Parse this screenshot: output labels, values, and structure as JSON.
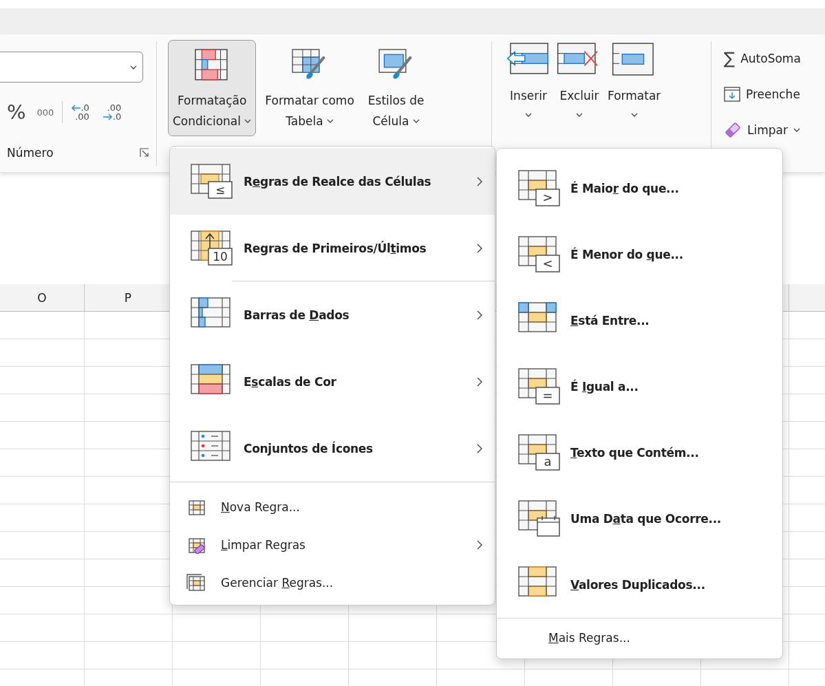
{
  "ribbon": {
    "number_group": {
      "label": "Número",
      "percent": "%",
      "thousands": "000",
      "decimal_buttons": [
        {
          "kind": "increase",
          "top": ".0",
          "bottom": ".00"
        },
        {
          "kind": "decrease",
          "top": ".00",
          "bottom": ".0"
        }
      ]
    },
    "style_buttons": [
      {
        "lines": [
          "Formatação",
          "Condicional"
        ],
        "dropdown": true,
        "pressed": true
      },
      {
        "lines": [
          "Formatar como",
          "Tabela"
        ],
        "dropdown": true,
        "pressed": false
      },
      {
        "lines": [
          "Estilos de",
          "Célula"
        ],
        "dropdown": true,
        "pressed": false
      }
    ],
    "cell_buttons": [
      {
        "label": "Inserir",
        "dropdown": true
      },
      {
        "label": "Excluir",
        "dropdown": true
      },
      {
        "label": "Formatar",
        "dropdown": true
      }
    ],
    "editing_buttons": [
      {
        "label": "AutoSoma",
        "icon_text": "∑",
        "dropdown": false
      },
      {
        "label": "Preenche",
        "dropdown": false
      },
      {
        "label": "Limpar",
        "dropdown": true
      }
    ]
  },
  "sheet": {
    "columns": [
      "O",
      "P"
    ]
  },
  "menu": {
    "items": [
      {
        "kind": "large",
        "label": {
          "before": "R",
          "key": "e",
          "after": "gras de Realce das Células"
        },
        "icon_text": "≤",
        "has_submenu": true,
        "selected": true,
        "separator_after": false
      },
      {
        "kind": "large",
        "label": {
          "before": "Regras de Primeiros/Úl",
          "key": "t",
          "after": "imos"
        },
        "icon_text": "10",
        "has_submenu": true,
        "selected": false,
        "separator_after": true
      },
      {
        "kind": "large",
        "label": {
          "before": "Barras de ",
          "key": "D",
          "after": "ados"
        },
        "has_submenu": true,
        "selected": false,
        "separator_after": false
      },
      {
        "kind": "large",
        "label": {
          "before": "E",
          "key": "s",
          "after": "calas de Cor"
        },
        "has_submenu": true,
        "selected": false,
        "separator_after": false
      },
      {
        "kind": "large",
        "label": "Conjuntos de Ícones",
        "has_submenu": true,
        "selected": false,
        "separator_after": false
      },
      {
        "kind": "small",
        "label": {
          "key": "N",
          "after": "ova Regra..."
        },
        "has_submenu": false,
        "selected": false,
        "separator_after": false
      },
      {
        "kind": "small",
        "label": {
          "key": "L",
          "after": "impar Regras"
        },
        "has_submenu": true,
        "selected": false,
        "separator_after": false
      },
      {
        "kind": "small",
        "label": {
          "before": "Gerenciar ",
          "key": "R",
          "after": "egras..."
        },
        "has_submenu": false,
        "selected": false,
        "separator_after": false
      }
    ]
  },
  "submenu": {
    "items": [
      {
        "label": {
          "before": "É Maio",
          "key": "r",
          "after": " do que..."
        },
        "icon_text": ">"
      },
      {
        "label": {
          "before": "É Menor do ",
          "key": "q",
          "after": "ue..."
        },
        "icon_text": "<"
      },
      {
        "label": {
          "key": "E",
          "after": "stá Entre..."
        }
      },
      {
        "label": {
          "before": "É ",
          "key": "I",
          "after": "gual a..."
        },
        "icon_text": "="
      },
      {
        "label": {
          "key": "T",
          "after": "exto que Contém..."
        },
        "icon_text": "a"
      },
      {
        "label": {
          "before": "Uma D",
          "key": "a",
          "after": "ta que Ocorre..."
        }
      },
      {
        "label": {
          "key": "V",
          "after": "alores Duplicados..."
        }
      }
    ],
    "more": {
      "label": {
        "key": "M",
        "after": "ais Regras..."
      }
    }
  }
}
